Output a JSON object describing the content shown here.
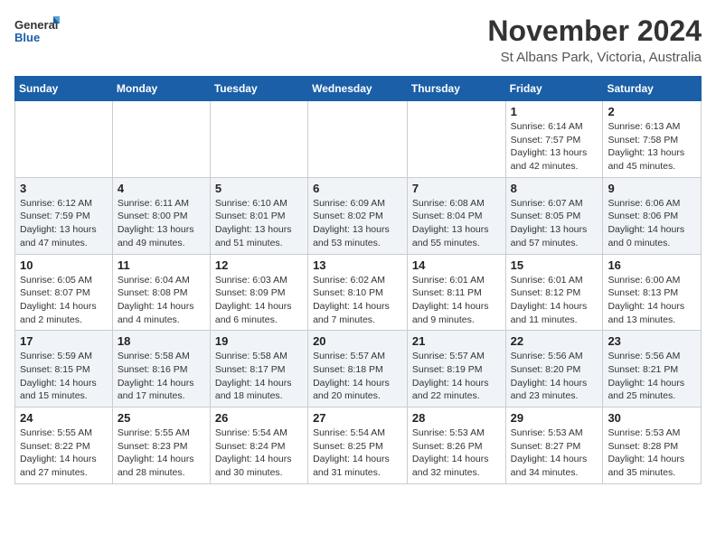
{
  "logo": {
    "general": "General",
    "blue": "Blue"
  },
  "header": {
    "month": "November 2024",
    "location": "St Albans Park, Victoria, Australia"
  },
  "weekdays": [
    "Sunday",
    "Monday",
    "Tuesday",
    "Wednesday",
    "Thursday",
    "Friday",
    "Saturday"
  ],
  "weeks": [
    [
      {
        "day": "",
        "info": ""
      },
      {
        "day": "",
        "info": ""
      },
      {
        "day": "",
        "info": ""
      },
      {
        "day": "",
        "info": ""
      },
      {
        "day": "",
        "info": ""
      },
      {
        "day": "1",
        "info": "Sunrise: 6:14 AM\nSunset: 7:57 PM\nDaylight: 13 hours\nand 42 minutes."
      },
      {
        "day": "2",
        "info": "Sunrise: 6:13 AM\nSunset: 7:58 PM\nDaylight: 13 hours\nand 45 minutes."
      }
    ],
    [
      {
        "day": "3",
        "info": "Sunrise: 6:12 AM\nSunset: 7:59 PM\nDaylight: 13 hours\nand 47 minutes."
      },
      {
        "day": "4",
        "info": "Sunrise: 6:11 AM\nSunset: 8:00 PM\nDaylight: 13 hours\nand 49 minutes."
      },
      {
        "day": "5",
        "info": "Sunrise: 6:10 AM\nSunset: 8:01 PM\nDaylight: 13 hours\nand 51 minutes."
      },
      {
        "day": "6",
        "info": "Sunrise: 6:09 AM\nSunset: 8:02 PM\nDaylight: 13 hours\nand 53 minutes."
      },
      {
        "day": "7",
        "info": "Sunrise: 6:08 AM\nSunset: 8:04 PM\nDaylight: 13 hours\nand 55 minutes."
      },
      {
        "day": "8",
        "info": "Sunrise: 6:07 AM\nSunset: 8:05 PM\nDaylight: 13 hours\nand 57 minutes."
      },
      {
        "day": "9",
        "info": "Sunrise: 6:06 AM\nSunset: 8:06 PM\nDaylight: 14 hours\nand 0 minutes."
      }
    ],
    [
      {
        "day": "10",
        "info": "Sunrise: 6:05 AM\nSunset: 8:07 PM\nDaylight: 14 hours\nand 2 minutes."
      },
      {
        "day": "11",
        "info": "Sunrise: 6:04 AM\nSunset: 8:08 PM\nDaylight: 14 hours\nand 4 minutes."
      },
      {
        "day": "12",
        "info": "Sunrise: 6:03 AM\nSunset: 8:09 PM\nDaylight: 14 hours\nand 6 minutes."
      },
      {
        "day": "13",
        "info": "Sunrise: 6:02 AM\nSunset: 8:10 PM\nDaylight: 14 hours\nand 7 minutes."
      },
      {
        "day": "14",
        "info": "Sunrise: 6:01 AM\nSunset: 8:11 PM\nDaylight: 14 hours\nand 9 minutes."
      },
      {
        "day": "15",
        "info": "Sunrise: 6:01 AM\nSunset: 8:12 PM\nDaylight: 14 hours\nand 11 minutes."
      },
      {
        "day": "16",
        "info": "Sunrise: 6:00 AM\nSunset: 8:13 PM\nDaylight: 14 hours\nand 13 minutes."
      }
    ],
    [
      {
        "day": "17",
        "info": "Sunrise: 5:59 AM\nSunset: 8:15 PM\nDaylight: 14 hours\nand 15 minutes."
      },
      {
        "day": "18",
        "info": "Sunrise: 5:58 AM\nSunset: 8:16 PM\nDaylight: 14 hours\nand 17 minutes."
      },
      {
        "day": "19",
        "info": "Sunrise: 5:58 AM\nSunset: 8:17 PM\nDaylight: 14 hours\nand 18 minutes."
      },
      {
        "day": "20",
        "info": "Sunrise: 5:57 AM\nSunset: 8:18 PM\nDaylight: 14 hours\nand 20 minutes."
      },
      {
        "day": "21",
        "info": "Sunrise: 5:57 AM\nSunset: 8:19 PM\nDaylight: 14 hours\nand 22 minutes."
      },
      {
        "day": "22",
        "info": "Sunrise: 5:56 AM\nSunset: 8:20 PM\nDaylight: 14 hours\nand 23 minutes."
      },
      {
        "day": "23",
        "info": "Sunrise: 5:56 AM\nSunset: 8:21 PM\nDaylight: 14 hours\nand 25 minutes."
      }
    ],
    [
      {
        "day": "24",
        "info": "Sunrise: 5:55 AM\nSunset: 8:22 PM\nDaylight: 14 hours\nand 27 minutes."
      },
      {
        "day": "25",
        "info": "Sunrise: 5:55 AM\nSunset: 8:23 PM\nDaylight: 14 hours\nand 28 minutes."
      },
      {
        "day": "26",
        "info": "Sunrise: 5:54 AM\nSunset: 8:24 PM\nDaylight: 14 hours\nand 30 minutes."
      },
      {
        "day": "27",
        "info": "Sunrise: 5:54 AM\nSunset: 8:25 PM\nDaylight: 14 hours\nand 31 minutes."
      },
      {
        "day": "28",
        "info": "Sunrise: 5:53 AM\nSunset: 8:26 PM\nDaylight: 14 hours\nand 32 minutes."
      },
      {
        "day": "29",
        "info": "Sunrise: 5:53 AM\nSunset: 8:27 PM\nDaylight: 14 hours\nand 34 minutes."
      },
      {
        "day": "30",
        "info": "Sunrise: 5:53 AM\nSunset: 8:28 PM\nDaylight: 14 hours\nand 35 minutes."
      }
    ]
  ]
}
